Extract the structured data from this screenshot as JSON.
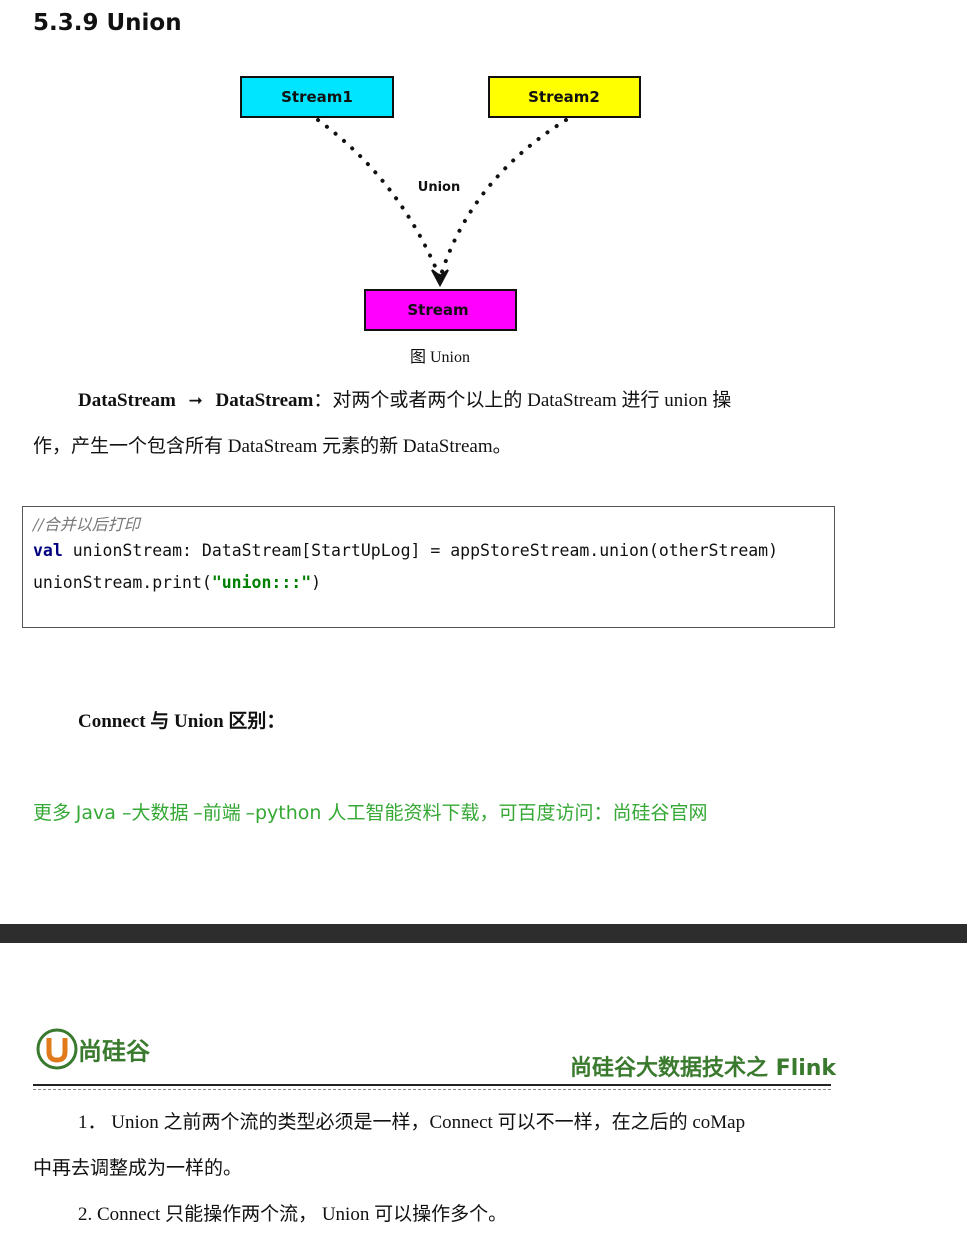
{
  "heading": "5.3.9 Union",
  "diagram": {
    "stream1": "Stream1",
    "stream2": "Stream2",
    "union_label": "Union",
    "stream": "Stream",
    "colors": {
      "stream1": "#00e5ff",
      "stream2": "#ffff00",
      "stream": "#ff00ff"
    }
  },
  "caption": "图 Union",
  "paragraph": {
    "from": "DataStream",
    "to": "DataStream",
    "text1": "：对两个或者两个以上的 DataStream 进行 union 操",
    "text2": "作，产生一个包含所有 DataStream 元素的新 DataStream。"
  },
  "code": {
    "comment": "//合并以后打印",
    "line2_kw": "val",
    "line2_rest": " unionStream: DataStream[StartUpLog] = appStoreStream.union(otherStream)",
    "line3_pre": "unionStream.print(",
    "line3_str": "\"union:::\"",
    "line3_post": ")"
  },
  "subheading": "Connect 与 Union 区别：",
  "promo": {
    "p1": "更多 ",
    "p2": "Java –",
    "p3": "大数据 ",
    "p4": "–",
    "p5": "前端 ",
    "p6": "–python ",
    "p7": "人工智能资料下载，可百度访问：尚硅谷官网"
  },
  "footer": {
    "logo_text": "尚硅谷",
    "title": "尚硅谷大数据技术之 Flink",
    "item1_line1": "1．  Union 之前两个流的类型必须是一样，Connect 可以不一样，在之后的 coMap",
    "item1_line2": "中再去调整成为一样的。",
    "item2": "2. Connect 只能操作两个流， Union 可以操作多个。"
  }
}
